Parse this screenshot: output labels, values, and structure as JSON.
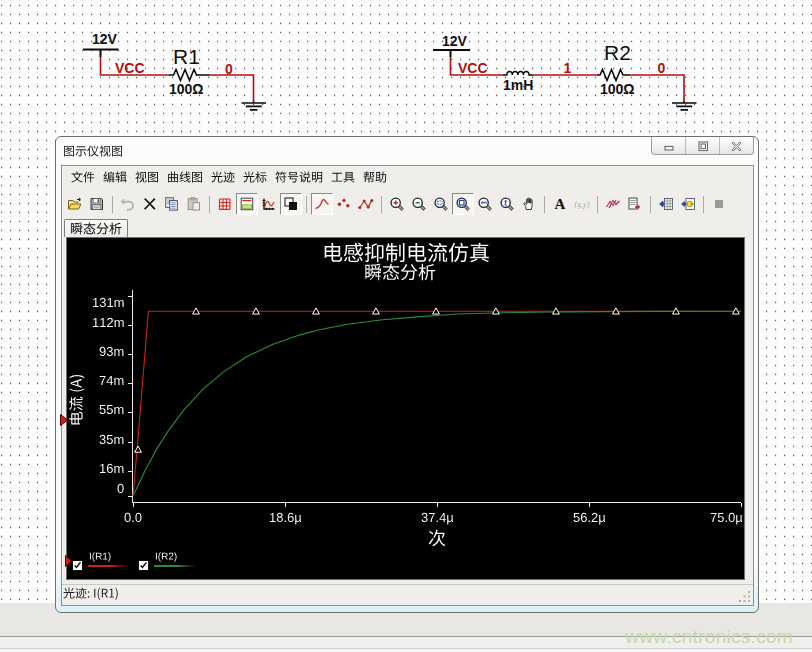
{
  "window": {
    "title": "图示仪视图",
    "controls": [
      {
        "key": "minimize",
        "label": "minimize"
      },
      {
        "key": "maximize",
        "label": "maximize"
      },
      {
        "key": "close",
        "label": "close"
      }
    ]
  },
  "menu": {
    "items": [
      {
        "key": "file",
        "label": "文件"
      },
      {
        "key": "edit",
        "label": "编辑"
      },
      {
        "key": "view",
        "label": "视图"
      },
      {
        "key": "graph",
        "label": "曲线图"
      },
      {
        "key": "trace",
        "label": "光迹"
      },
      {
        "key": "cursor",
        "label": "光标"
      },
      {
        "key": "legend",
        "label": "符号说明"
      },
      {
        "key": "tools",
        "label": "工具"
      },
      {
        "key": "help",
        "label": "帮助"
      }
    ]
  },
  "toolbar": {
    "items": [
      {
        "key": "open"
      },
      {
        "key": "save"
      },
      {
        "key": "sep"
      },
      {
        "key": "undo",
        "disabled": true
      },
      {
        "key": "delete"
      },
      {
        "key": "copy"
      },
      {
        "key": "paste",
        "disabled": true
      },
      {
        "key": "sep"
      },
      {
        "key": "grid"
      },
      {
        "key": "show-legend",
        "pressed": true
      },
      {
        "key": "graph-properties"
      },
      {
        "key": "invert-colors",
        "pressed": true
      },
      {
        "key": "sep"
      },
      {
        "key": "line-plot",
        "pressed": true
      },
      {
        "key": "scatter-plot"
      },
      {
        "key": "line-markers"
      },
      {
        "key": "sep"
      },
      {
        "key": "zoom-in"
      },
      {
        "key": "zoom-out"
      },
      {
        "key": "zoom-window"
      },
      {
        "key": "zoom-fit",
        "pressed": true
      },
      {
        "key": "zoom-x"
      },
      {
        "key": "zoom-y"
      },
      {
        "key": "pan"
      },
      {
        "key": "sep"
      },
      {
        "key": "text-annotation"
      },
      {
        "key": "show-coordinates",
        "disabled": true
      },
      {
        "key": "sep"
      },
      {
        "key": "overlay-traces"
      },
      {
        "key": "export-graph"
      },
      {
        "key": "sep"
      },
      {
        "key": "export-excel"
      },
      {
        "key": "export-data"
      },
      {
        "key": "sep"
      },
      {
        "key": "stop",
        "disabled": true
      }
    ]
  },
  "tabs": [
    {
      "key": "transient",
      "label": "瞬态分析",
      "active": true
    }
  ],
  "status_bar": {
    "text": "光迹: I(R1)"
  },
  "watermark": {
    "text": "www.cntronics.com"
  },
  "schematic": {
    "components": [
      {
        "id": "v1",
        "type": "vcc-source",
        "voltage": "12V"
      },
      {
        "id": "r1",
        "type": "resistor",
        "ref": "R1",
        "value": "100Ω"
      },
      {
        "id": "gnd1",
        "type": "ground"
      },
      {
        "id": "v2",
        "type": "vcc-source",
        "voltage": "12V"
      },
      {
        "id": "l1",
        "type": "inductor",
        "value": "1mH"
      },
      {
        "id": "r2",
        "type": "resistor",
        "ref": "R2",
        "value": "100Ω"
      },
      {
        "id": "gnd2",
        "type": "ground"
      }
    ],
    "labels": [
      {
        "id": "v1-voltage",
        "text": "12V",
        "cls": "val"
      },
      {
        "id": "net-vcc-1",
        "text": "VCC",
        "cls": "net"
      },
      {
        "id": "r1-ref",
        "text": "R1",
        "cls": "ref"
      },
      {
        "id": "net-0-1",
        "text": "0",
        "cls": "net"
      },
      {
        "id": "r1-value",
        "text": "100Ω",
        "cls": "val"
      },
      {
        "id": "v2-voltage",
        "text": "12V",
        "cls": "val"
      },
      {
        "id": "net-vcc-2",
        "text": "VCC",
        "cls": "net"
      },
      {
        "id": "l1-value",
        "text": "1mH",
        "cls": "val"
      },
      {
        "id": "net-1",
        "text": "1",
        "cls": "net"
      },
      {
        "id": "r2-ref",
        "text": "R2",
        "cls": "ref"
      },
      {
        "id": "net-0-2",
        "text": "0",
        "cls": "net"
      },
      {
        "id": "r2-value",
        "text": "100Ω",
        "cls": "val"
      }
    ]
  },
  "chart_data": {
    "type": "line",
    "title": "电感抑制电流仿真",
    "subtitle": "瞬态分析",
    "xlabel": "次",
    "ylabel": "电流 (A)",
    "x_unit": "µs",
    "y_unit": "mA",
    "xlim": [
      0,
      75
    ],
    "ylim": [
      0,
      131
    ],
    "grid": false,
    "background": "#000000",
    "x_ticks": [
      {
        "v": 0,
        "label": "0.0"
      },
      {
        "v": 18.75,
        "label": "18.6µ"
      },
      {
        "v": 37.5,
        "label": "37.4µ"
      },
      {
        "v": 56.25,
        "label": "56.2µ"
      },
      {
        "v": 75,
        "label": "75.0µ"
      }
    ],
    "y_ticks": [
      {
        "v": 0,
        "label": "0"
      },
      {
        "v": 16,
        "label": "16m"
      },
      {
        "v": 35,
        "label": "35m"
      },
      {
        "v": 55,
        "label": "55m"
      },
      {
        "v": 74,
        "label": "74m"
      },
      {
        "v": 93,
        "label": "93m"
      },
      {
        "v": 112,
        "label": "112m"
      },
      {
        "v": 131,
        "label": "131m"
      }
    ],
    "series": [
      {
        "name": "I(R1)",
        "color": "#cc1f1f",
        "points": [
          [
            0,
            0
          ],
          [
            0.5,
            30.5
          ],
          [
            1.9,
            121
          ],
          [
            75,
            121
          ]
        ],
        "markers": [
          [
            0.62,
            30.5
          ],
          [
            7.77,
            121
          ],
          [
            15.17,
            121
          ],
          [
            22.57,
            121
          ],
          [
            29.97,
            121
          ],
          [
            37.37,
            121
          ],
          [
            44.77,
            121
          ],
          [
            52.17,
            121
          ],
          [
            59.57,
            121
          ],
          [
            66.97,
            121
          ],
          [
            74.37,
            121
          ]
        ]
      },
      {
        "name": "I(R2)",
        "color": "#2f8a35",
        "points": [
          [
            0,
            0
          ],
          [
            1.5,
            16.9
          ],
          [
            2.9,
            30.5
          ],
          [
            4.3,
            42.3
          ],
          [
            6.3,
            56.6
          ],
          [
            8.7,
            70.3
          ],
          [
            11.2,
            81.5
          ],
          [
            14,
            91.2
          ],
          [
            17.2,
            99.3
          ],
          [
            20.5,
            105.4
          ],
          [
            23,
            108.9
          ],
          [
            26.5,
            112.5
          ],
          [
            30.5,
            115.3
          ],
          [
            35,
            117.3
          ],
          [
            40,
            119.2
          ],
          [
            45.5,
            120.0
          ],
          [
            51.5,
            120.5
          ],
          [
            58,
            120.8
          ],
          [
            65,
            120.9
          ],
          [
            75,
            121.0
          ]
        ],
        "markers": []
      }
    ],
    "legend": [
      {
        "label": "I(R1)",
        "color": "#cc1f1f",
        "checked": true,
        "selected": true
      },
      {
        "label": "I(R2)",
        "color": "#2f8a35",
        "checked": true,
        "selected": false
      }
    ]
  }
}
